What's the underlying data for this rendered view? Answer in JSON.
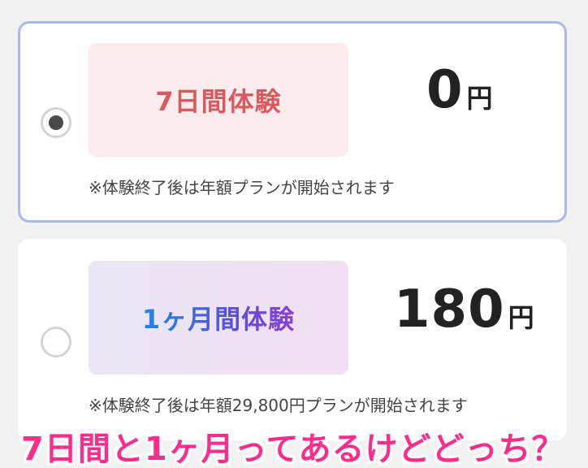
{
  "plans": [
    {
      "label": "7日間体験",
      "price": "0",
      "unit": "円",
      "note": "※体験終了後は年額プランが開始されます",
      "selected": true
    },
    {
      "label": "1ヶ月間体験",
      "price": "180",
      "unit": "円",
      "note": "※体験終了後は年額29,800円プランが開始されます",
      "selected": false
    }
  ],
  "caption": "7日間と1ヶ月ってあるけどどっち？",
  "colors": {
    "selected_border": "#a9b6f2",
    "trial7_text": "#d85a5e",
    "trial7_bg": "#fdeced",
    "caption": "#ff2d8a"
  }
}
